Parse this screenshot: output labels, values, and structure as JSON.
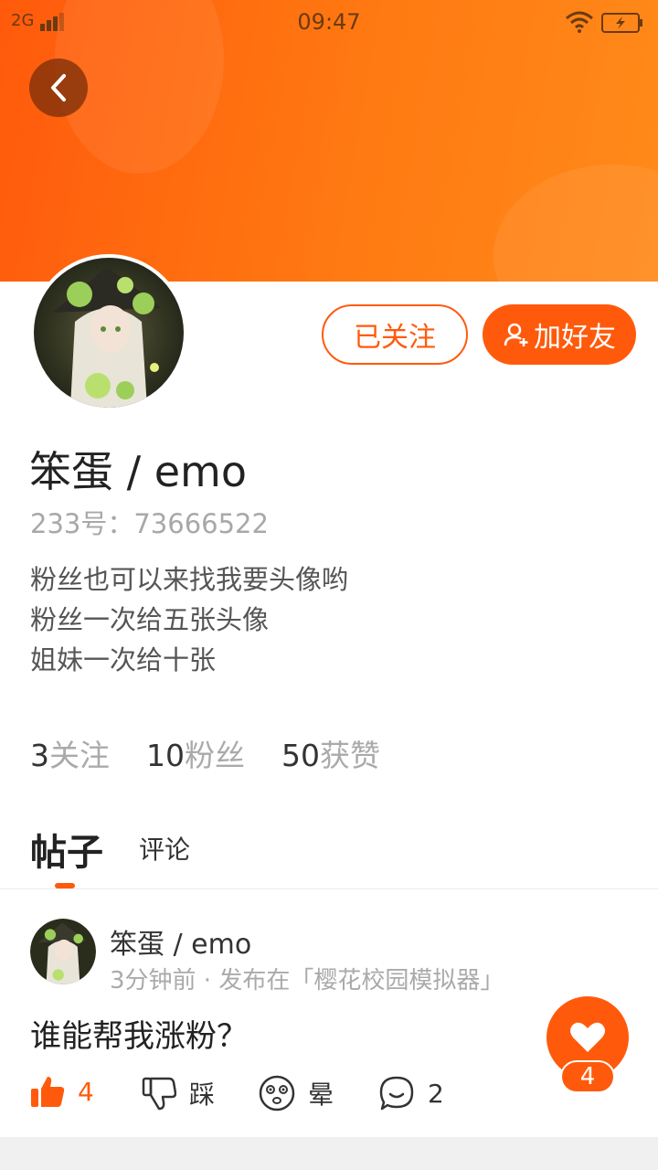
{
  "status_bar": {
    "network": "2G",
    "time": "09:47"
  },
  "profile": {
    "followed_label": "已关注",
    "add_friend_label": "加好友",
    "username": "笨蛋 / emo",
    "uid": "233号：73666522",
    "bio": [
      "粉丝也可以来找我要头像哟",
      "粉丝一次给五张头像",
      "姐妹一次给十张"
    ],
    "stats": [
      {
        "num": "3",
        "label": "关注"
      },
      {
        "num": "10",
        "label": "粉丝"
      },
      {
        "num": "50",
        "label": "获赞"
      }
    ]
  },
  "tabs": {
    "posts": "帖子",
    "comments": "评论"
  },
  "post": {
    "username": "笨蛋 / emo",
    "meta": "3分钟前 · 发布在「樱花校园模拟器」",
    "text": "谁能帮我涨粉？",
    "like_count": "4",
    "dislike_label": "踩",
    "dizzy_label": "晕",
    "comment_count": "2"
  },
  "fab": {
    "count": "4"
  },
  "colors": {
    "accent": "#ff5a0c",
    "header_gradient_end": "#ff8a1a"
  },
  "icons": [
    "back-arrow-icon",
    "add-user-icon",
    "thumbs-up-icon",
    "thumbs-down-icon",
    "dizzy-face-icon",
    "comment-bubble-icon",
    "heart-icon",
    "wifi-icon",
    "battery-icon",
    "signal-icon"
  ]
}
